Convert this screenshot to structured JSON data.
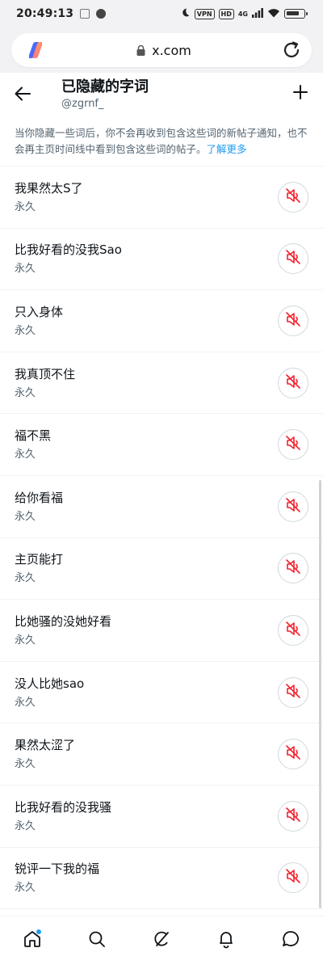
{
  "status_bar": {
    "time": "20:49:13",
    "vpn": "VPN",
    "hd": "HD",
    "network": "4G"
  },
  "browser": {
    "url": "x.com"
  },
  "header": {
    "title": "已隐藏的字词",
    "handle": "@zgrnf_"
  },
  "description": {
    "text": "当你隐藏一些词后，你不会再收到包含这些词的新帖子通知，也不会再主页时间线中看到包含这些词的帖子。",
    "link": "了解更多"
  },
  "muted_words": [
    {
      "word": "我果然太S了",
      "duration": "永久"
    },
    {
      "word": "比我好看的没我Sao",
      "duration": "永久"
    },
    {
      "word": "只入身体",
      "duration": "永久"
    },
    {
      "word": "我真顶不住",
      "duration": "永久"
    },
    {
      "word": "福不黑",
      "duration": "永久"
    },
    {
      "word": "给你看福",
      "duration": "永久"
    },
    {
      "word": "主页能打",
      "duration": "永久"
    },
    {
      "word": "比她骚的没她好看",
      "duration": "永久"
    },
    {
      "word": "没人比她sao",
      "duration": "永久"
    },
    {
      "word": "果然太涩了",
      "duration": "永久"
    },
    {
      "word": "比我好看的没我骚",
      "duration": "永久"
    },
    {
      "word": "锐评一下我的福",
      "duration": "永久"
    }
  ],
  "icons": {
    "back": "arrow-left-icon",
    "add": "plus-icon",
    "unmute": "speaker-muted-icon",
    "home": "home-icon",
    "explore": "search-icon",
    "grok": "grok-icon",
    "notifications": "bell-icon",
    "messages": "message-icon",
    "reload": "reload-icon",
    "lock": "lock-icon",
    "copilot": "copilot-icon"
  },
  "colors": {
    "accent": "#1d9bf0",
    "muted_icon": "#f4212e",
    "secondary_text": "#536471"
  }
}
